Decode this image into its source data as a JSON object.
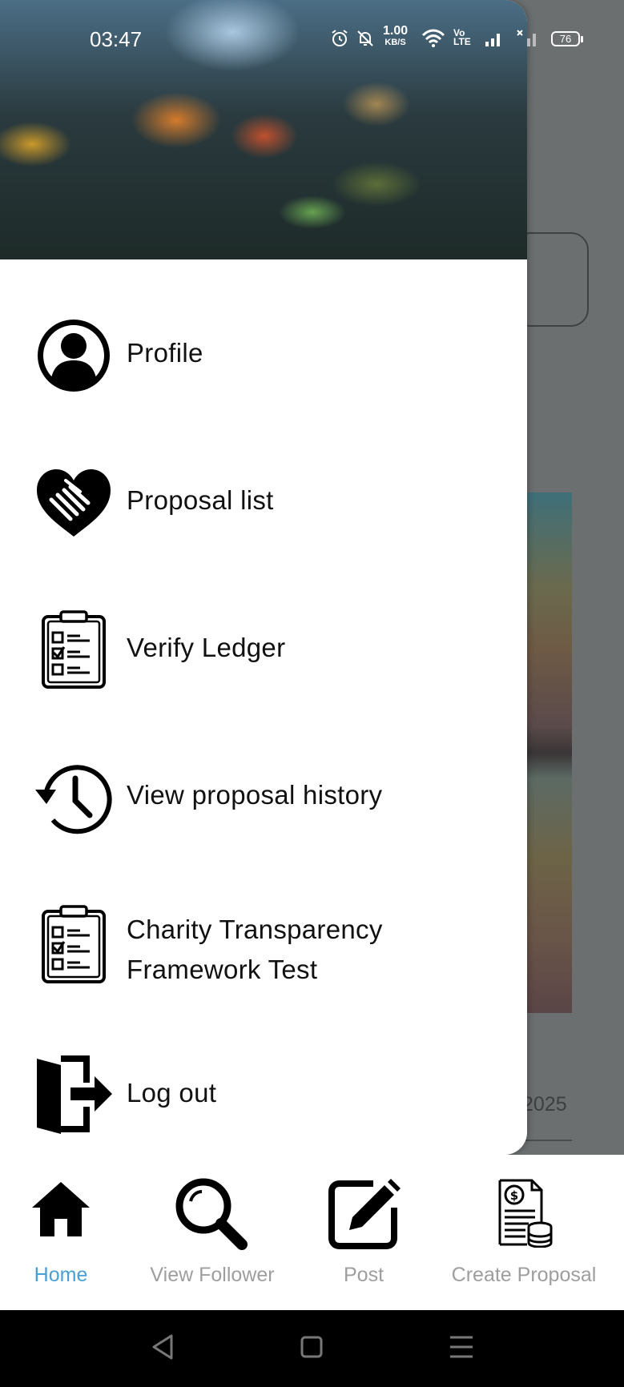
{
  "status_bar": {
    "time": "03:47",
    "speed_value": "1.00",
    "speed_unit": "KB/S",
    "volte": "Vo",
    "volte_sub": "LTE",
    "battery": "76"
  },
  "background": {
    "date_fragment": "2025"
  },
  "drawer": {
    "items": [
      {
        "label": "Profile",
        "icon": "profile-icon"
      },
      {
        "label": "Proposal list",
        "icon": "heart-handshake-icon"
      },
      {
        "label": "Verify Ledger",
        "icon": "clipboard-checklist-icon"
      },
      {
        "label": "View proposal history",
        "icon": "history-icon"
      },
      {
        "label_line1": "Charity Transparency",
        "label_line2": "Framework Test",
        "icon": "clipboard-checklist-icon"
      },
      {
        "label": "Log out",
        "icon": "logout-icon"
      }
    ]
  },
  "bottom_nav": {
    "items": [
      {
        "label": "Home",
        "icon": "home-icon",
        "active": true
      },
      {
        "label": "View Follower",
        "icon": "search-icon",
        "active": false
      },
      {
        "label": "Post",
        "icon": "edit-icon",
        "active": false
      },
      {
        "label": "Create Proposal",
        "icon": "invoice-coins-icon",
        "active": false
      }
    ]
  },
  "colors": {
    "active_nav": "#4aa0d4",
    "inactive_nav": "#9e9e9e",
    "scrim": "#6b6f70"
  }
}
